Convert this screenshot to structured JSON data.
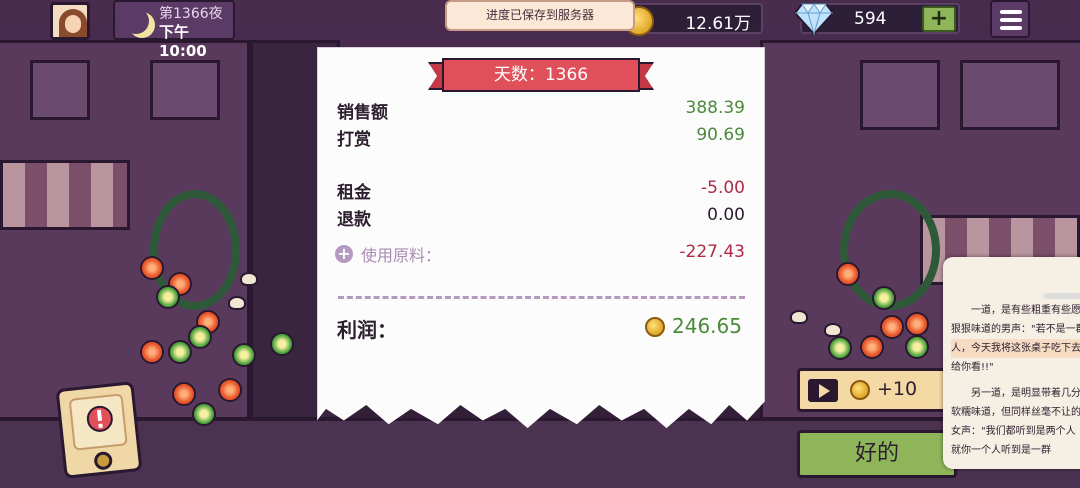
{
  "player": {
    "day_label": "第1366夜",
    "time_label": "下午10:00"
  },
  "toast": {
    "text": "进度已保存到服务器"
  },
  "currency": {
    "coins": "12.61万",
    "gems": "594",
    "plus_label": "+"
  },
  "receipt": {
    "title": "天数：1366",
    "rows": [
      {
        "label": "销售额",
        "value": "388.39"
      },
      {
        "label": "打赏",
        "value": "90.69"
      },
      {
        "label": "租金",
        "value": "-5.00"
      },
      {
        "label": "退款",
        "value": "0.00"
      }
    ],
    "ingredients_label": "使用原料：",
    "ingredients_value": "-227.43",
    "add_icon": "+",
    "profit_label": "利润：",
    "profit_value": "246.65"
  },
  "ad_reward": {
    "amount": "+10"
  },
  "ok_button": {
    "label": "好的"
  },
  "reader": {
    "p1_a": "一道，是有些粗重有些愿",
    "p1_b": "狠狠味道的男声：\"若不是一群",
    "p1_c": "人，今天我将这张桌子吃下去",
    "p1_d": "给你看!!\"",
    "p2_a": "另一道，是明显带着几分",
    "p2_b": "软糯味道，但同样丝毫不让的",
    "p2_c": "女声：\"我们都听到是两个人",
    "p2_d": "就你一个人听到是一群"
  },
  "icons": {
    "avatar": "avatar",
    "moon": "moon-icon",
    "coin": "coin-icon",
    "gem": "diamond-icon",
    "menu": "hamburger-menu-icon",
    "alert": "exclamation-icon",
    "play": "play-video-icon"
  },
  "colors": {
    "positive": "#4a8a3a",
    "negative": "#b02a45",
    "ok_button": "#8fb55a",
    "ribbon": "#e0505a"
  }
}
